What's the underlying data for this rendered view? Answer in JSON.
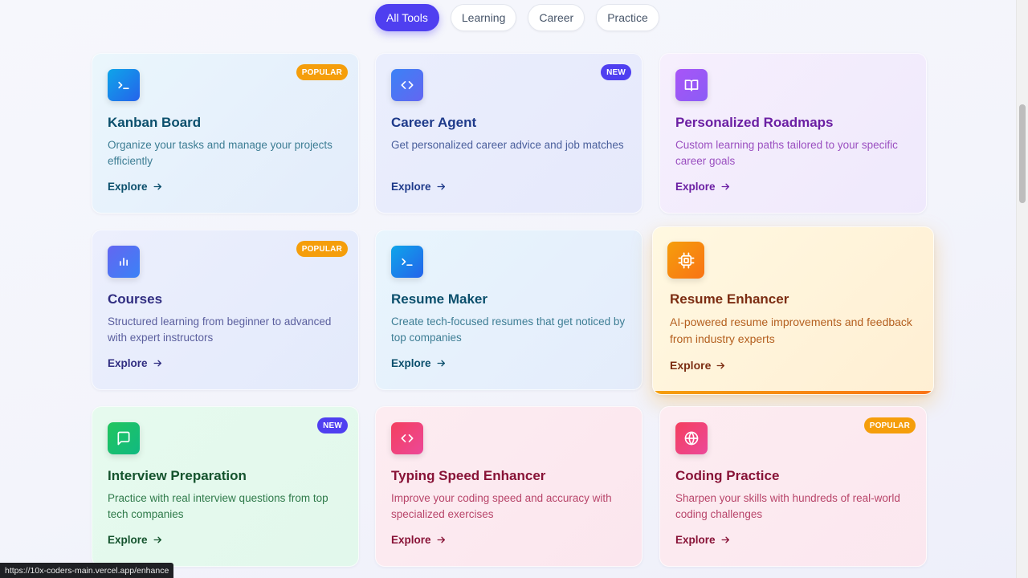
{
  "tabs": [
    {
      "label": "All Tools",
      "active": true
    },
    {
      "label": "Learning",
      "active": false
    },
    {
      "label": "Career",
      "active": false
    },
    {
      "label": "Practice",
      "active": false
    }
  ],
  "cards": [
    {
      "title": "Kanban Board",
      "description": "Organize your tasks and manage your projects efficiently",
      "explore": "Explore",
      "badge": "POPULAR",
      "icon": "terminal-icon"
    },
    {
      "title": "Career Agent",
      "description": "Get personalized career advice and job matches",
      "explore": "Explore",
      "badge": "NEW",
      "icon": "code-icon"
    },
    {
      "title": "Personalized Roadmaps",
      "description": "Custom learning paths tailored to your specific career goals",
      "explore": "Explore",
      "badge": "",
      "icon": "book-open-icon"
    },
    {
      "title": "Courses",
      "description": "Structured learning from beginner to advanced with expert instructors",
      "explore": "Explore",
      "badge": "POPULAR",
      "icon": "bar-chart-icon"
    },
    {
      "title": "Resume Maker",
      "description": "Create tech-focused resumes that get noticed by top companies",
      "explore": "Explore",
      "badge": "",
      "icon": "terminal-icon"
    },
    {
      "title": "Resume Enhancer",
      "description": "AI-powered resume improvements and feedback from industry experts",
      "explore": "Explore",
      "badge": "",
      "icon": "cpu-icon"
    },
    {
      "title": "Interview Preparation",
      "description": "Practice with real interview questions from top tech companies",
      "explore": "Explore",
      "badge": "NEW",
      "icon": "message-square-icon"
    },
    {
      "title": "Typing Speed Enhancer",
      "description": "Improve your coding speed and accuracy with specialized exercises",
      "explore": "Explore",
      "badge": "",
      "icon": "code-icon"
    },
    {
      "title": "Coding Practice",
      "description": "Sharpen your skills with hundreds of real-world coding challenges",
      "explore": "Explore",
      "badge": "POPULAR",
      "icon": "globe-icon"
    }
  ],
  "status_url": "https://10x-coders-main.vercel.app/enhance",
  "colors": {
    "accent": "#4f3ff0",
    "popular_badge": "#f59e0b",
    "new_badge": "#4f3ff0"
  }
}
